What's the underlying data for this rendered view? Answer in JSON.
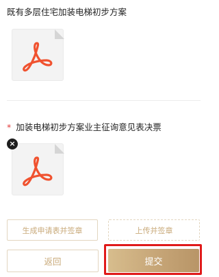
{
  "section1": {
    "title": "既有多层住宅加装电梯初步方案",
    "file_icon": "pdf-file-icon"
  },
  "section2": {
    "required_mark": "*",
    "title": "加装电梯初步方案业主征询意见表决票",
    "delete_symbol": "×",
    "file_icon": "pdf-file-icon"
  },
  "actions": {
    "generate_label": "生成申请表并签章",
    "upload_label": "上传并签章",
    "back_label": "返回",
    "submit_label": "提交"
  },
  "colors": {
    "accent": "#c9aa7a",
    "highlight_border": "#e01919",
    "pdf_red": "#f0522f"
  }
}
